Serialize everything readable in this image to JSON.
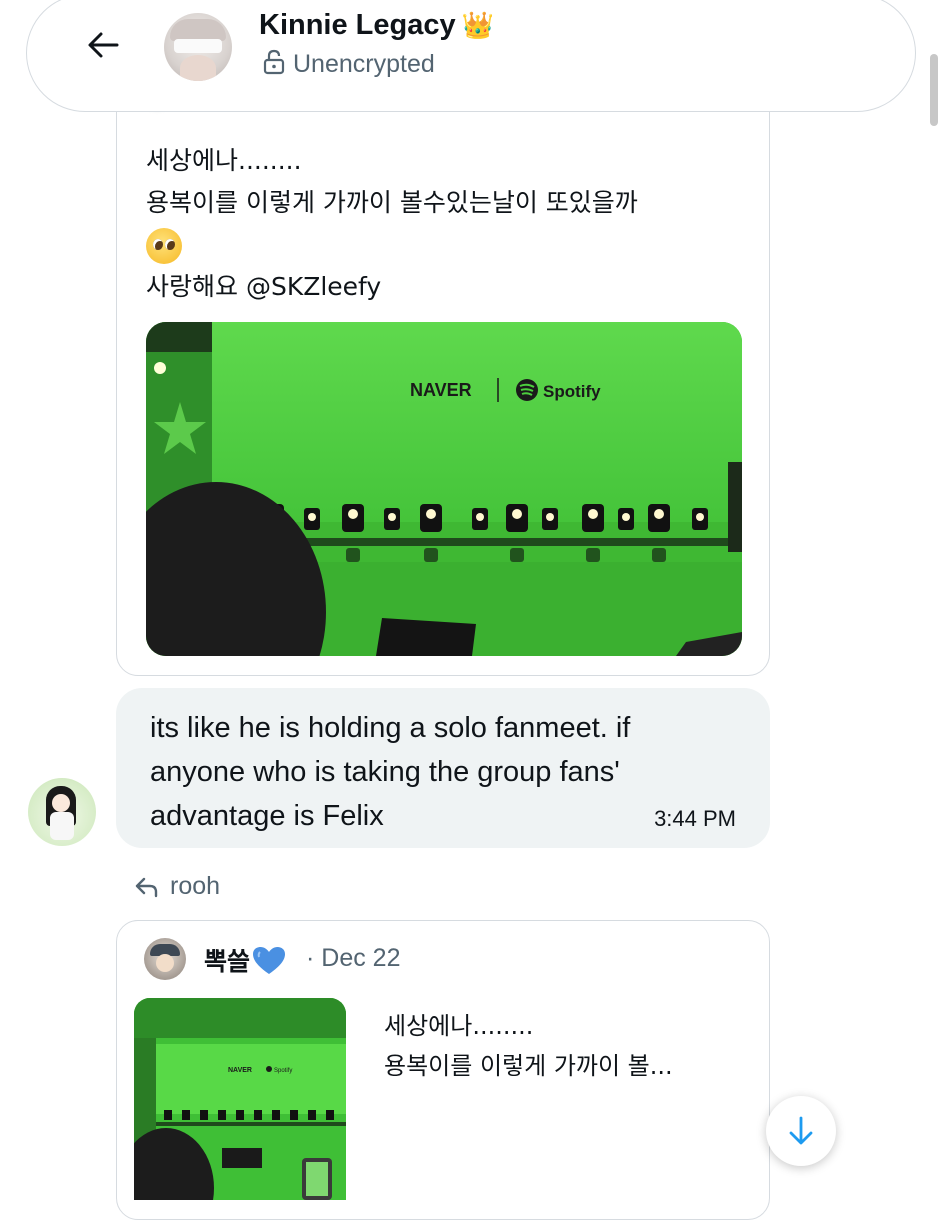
{
  "header": {
    "back_icon": "arrow-left-icon",
    "title": "Kinnie Legacy",
    "title_emoji": "👑",
    "subtitle": "Unencrypted",
    "lock_icon": "unlocked-padlock-icon"
  },
  "quoted_post_1": {
    "lines": [
      "세상에나........",
      "용복이를 이렇게 가까이 볼수있는날이 또있을까",
      "사랑해요 @SKZleefy"
    ],
    "emoji": "pleading-face-emoji",
    "photo": {
      "logos": [
        "NAVER",
        "Spotify"
      ],
      "description_colors": {
        "screen": "#4ccf3e"
      }
    }
  },
  "message": {
    "text": "its like he is holding a solo fanmeet. if anyone who is taking the group fans' advantage is Felix",
    "time": "3:44 PM",
    "bubble_color": "#eff3f4"
  },
  "reply": {
    "label": "rooh",
    "icon": "reply-arrow-icon"
  },
  "quoted_post_2": {
    "author": "뽁쓸",
    "author_emoji": "💙",
    "date": "· Dec 22",
    "lines": [
      "세상에나........",
      "용복이를 이렇게 가까이 볼..."
    ],
    "photo_logos": [
      "NAVER",
      "Spotify"
    ]
  },
  "scroll_down_icon": "arrow-down-icon",
  "colors": {
    "accent": "#1d9bf0",
    "secondary_text": "#536471",
    "border": "#d6dbe0"
  }
}
